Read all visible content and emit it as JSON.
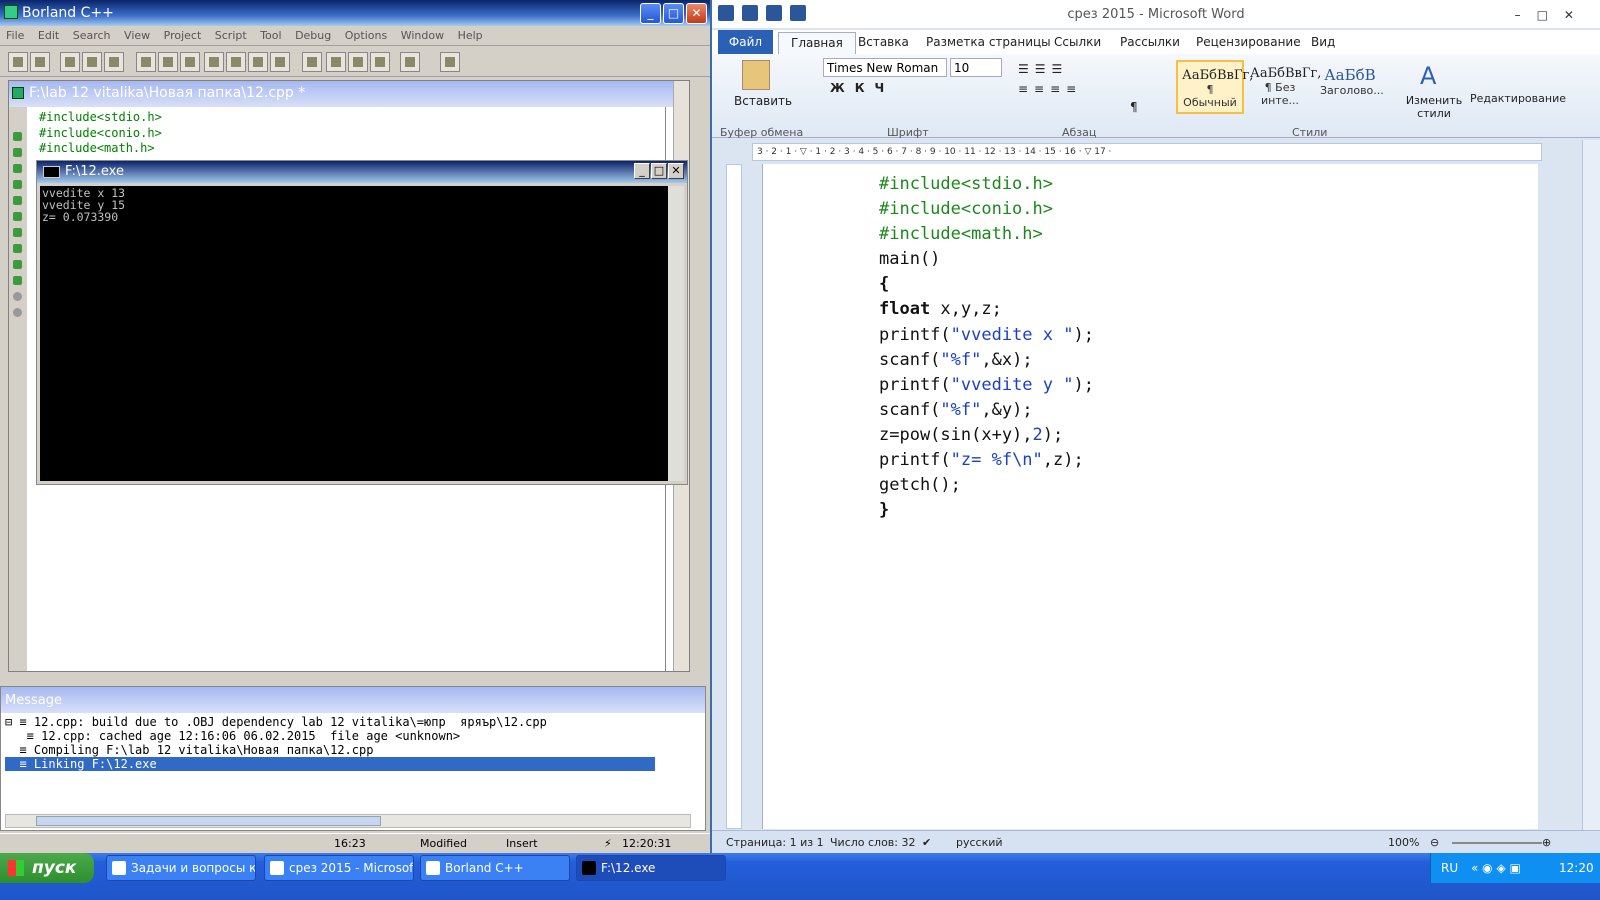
{
  "borland": {
    "title": "Borland C++",
    "menu": [
      "File",
      "Edit",
      "Search",
      "View",
      "Project",
      "Script",
      "Tool",
      "Debug",
      "Options",
      "Window",
      "Help"
    ],
    "editor_title": "F:\\lab 12 vitalika\\Новая папка\\12.cpp *",
    "code_lines": [
      "#include<stdio.h>",
      "#include<conio.h>",
      "#include<math.h>"
    ],
    "message_title": "Message",
    "messages": [
      "⊟ ≡ 12.cpp: build due to .OBJ dependency lab 12 vitalika\\=юпр  яряър\\12.cpp",
      "   ≡ 12.cpp: cached age 12:16:06 06.02.2015  file age <unknown>",
      "  ≡ Compiling F:\\lab 12 vitalika\\Новая папка\\12.cpp",
      "  ≡ Linking F:\\12.exe"
    ],
    "status": {
      "position": "16:23",
      "modified": "Modified",
      "mode": "Insert",
      "time": "12:20:31"
    }
  },
  "console": {
    "title": "F:\\12.exe",
    "output": [
      "vvedite x 13",
      "vvedite y 15",
      "z= 0.073390"
    ]
  },
  "word": {
    "title": "срез 2015  -  Microsoft Word",
    "tabs": [
      "Файл",
      "Главная",
      "Вставка",
      "Разметка страницы",
      "Ссылки",
      "Рассылки",
      "Рецензирование",
      "Вид"
    ],
    "paste_label": "Вставить",
    "font_name": "Times New Roman",
    "font_size": "10",
    "styles": [
      {
        "preview": "АаБбВвГг,",
        "name": "¶ Обычный"
      },
      {
        "preview": "АаБбВвГг,",
        "name": "¶ Без инте..."
      },
      {
        "preview": "АаБбВ",
        "name": "Заголово..."
      }
    ],
    "change_styles": "Изменить стили",
    "editing": "Редактирование",
    "groups": [
      "Буфер обмена",
      "Шрифт",
      "Абзац",
      "Стили"
    ],
    "ruler": "3 · 2 · 1 · ▽ · 1 · 2 · 3 · 4 · 5 · 6 · 7 · 8 · 9 · 10 · 11 · 12 · 13 · 14 · 15 · 16 · ▽ 17 · ",
    "doc_lines": [
      {
        "t": "#include<stdio.h>",
        "c": "g"
      },
      {
        "t": "#include<conio.h>",
        "c": "g"
      },
      {
        "t": "#include<math.h>",
        "c": "g"
      },
      {
        "t": "main()",
        "c": ""
      },
      {
        "t": "{",
        "c": "k"
      },
      {
        "t": "float",
        "c": "k",
        "rest": " x,y,z;"
      },
      {
        "t": "printf(",
        "c": "",
        "str": "\"vvedite x \"",
        "rest": ");"
      },
      {
        "t": "scanf(",
        "c": "",
        "str": "\"%f\"",
        "rest": ",&x);"
      },
      {
        "t": "printf(",
        "c": "",
        "str": "\"vvedite y \"",
        "rest": ");"
      },
      {
        "t": "scanf(",
        "c": "",
        "str": "\"%f\"",
        "rest": ",&y);"
      },
      {
        "t": "z=pow(sin(x+y),",
        "c": "",
        "str": "2",
        "rest": ");"
      },
      {
        "t": "printf(",
        "c": "",
        "str": "\"z= %f\\n\"",
        "rest": ",z);"
      },
      {
        "t": "getch();",
        "c": ""
      },
      {
        "t": "}",
        "c": "k"
      }
    ],
    "status": {
      "page": "Страница: 1 из 1",
      "words": "Число слов: 32",
      "lang": "русский",
      "zoom": "100%"
    }
  },
  "taskbar": {
    "start": "пуск",
    "tasks": [
      "Задачи и вопросы к ...",
      "срез 2015 - Microsoft...",
      "Borland C++",
      "F:\\12.exe"
    ],
    "lang": "RU",
    "clock": "12:20"
  }
}
